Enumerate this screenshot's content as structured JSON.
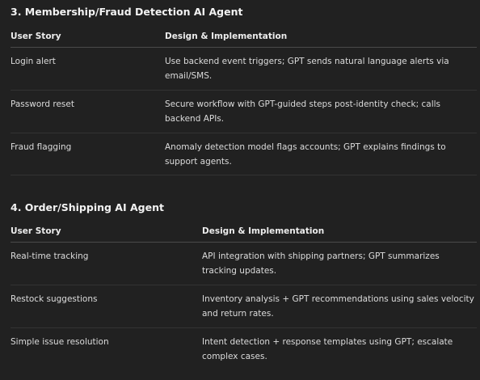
{
  "sections": [
    {
      "title": "3. Membership/Fraud Detection AI Agent",
      "headers": [
        "User Story",
        "Design & Implementation"
      ],
      "rows": [
        [
          "Login alert",
          "Use backend event triggers; GPT sends natural language alerts via email/SMS."
        ],
        [
          "Password reset",
          "Secure workflow with GPT-guided steps post-identity check; calls backend APIs."
        ],
        [
          "Fraud flagging",
          "Anomaly detection model flags accounts; GPT explains findings to support agents."
        ]
      ]
    },
    {
      "title": "4. Order/Shipping AI Agent",
      "headers": [
        "User Story",
        "Design & Implementation"
      ],
      "rows": [
        [
          "Real-time tracking",
          "API integration with shipping partners; GPT summarizes tracking updates."
        ],
        [
          "Restock suggestions",
          "Inventory analysis + GPT recommendations using sales velocity and return rates."
        ],
        [
          "Simple issue resolution",
          "Intent detection + response templates using GPT; escalate complex cases."
        ]
      ]
    }
  ]
}
